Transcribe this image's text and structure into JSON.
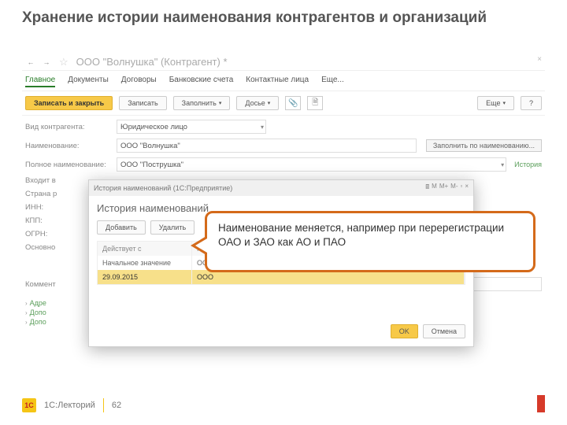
{
  "slide": {
    "title": "Хранение истории наименования контрагентов и организаций"
  },
  "window": {
    "title": "ООО \"Волнушка\" (Контрагент) *"
  },
  "tabs": {
    "main": "Главное",
    "docs": "Документы",
    "contracts": "Договоры",
    "bank": "Банковские счета",
    "contacts": "Контактные лица",
    "more": "Еще..."
  },
  "toolbar": {
    "save_close": "Записать и закрыть",
    "save": "Записать",
    "fill": "Заполнить",
    "dossier": "Досье",
    "more": "Еще",
    "help": "?"
  },
  "form": {
    "type_label": "Вид контрагента:",
    "type_value": "Юридическое лицо",
    "name_label": "Наименование:",
    "name_value": "ООО \"Волнушка\"",
    "fill_by_name": "Заполнить по наименованию...",
    "fullname_label": "Полное наименование:",
    "fullname_value": "ООО \"Пострушка\"",
    "history_link": "История",
    "member_label": "Входит в",
    "country_label": "Страна р",
    "inn_label": "ИНН:",
    "kpp_label": "КПП:",
    "ogrn_label": "ОГРН:",
    "main_label": "Основно",
    "comment_label": "Коммент"
  },
  "side": {
    "addr": "Адре",
    "add1": "Допо",
    "add2": "Допо"
  },
  "dialog": {
    "sys_title": "История наименований (1С:Предприятие)",
    "heading": "История наименований",
    "add": "Добавить",
    "delete": "Удалить",
    "win_m1": "М",
    "win_m2": "М+",
    "win_m3": "М-",
    "col1": "Действует с",
    "col2": "Полн",
    "row1_c1": "Начальное значение",
    "row1_c2": "ООО",
    "row2_c1": "29.09.2015",
    "row2_c2": "ООО",
    "ok": "OK",
    "cancel": "Отмена"
  },
  "callout": {
    "text": "Наименование меняется, например при перерегистрации ОАО и ЗАО как АО и ПАО"
  },
  "footer": {
    "brand_logo": "1С",
    "brand": "1С:Лекторий",
    "page": "62"
  }
}
